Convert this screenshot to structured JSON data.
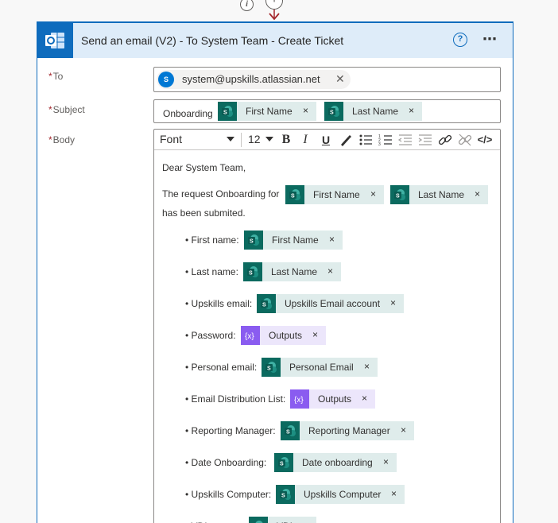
{
  "card": {
    "title": "Send an email (V2) - To System Team - Create Ticket",
    "help_symbol": "?",
    "more_symbol": "⋯"
  },
  "fields": {
    "to_label": "To",
    "subject_label": "Subject",
    "body_label": "Body",
    "required_mark": "*"
  },
  "to": {
    "avatar_initial": "S",
    "email": "system@upskills.atlassian.net"
  },
  "subject": {
    "prefix": "Onboarding",
    "tokens": [
      "First Name",
      "Last Name"
    ]
  },
  "toolbar": {
    "font": "Font",
    "size": "12"
  },
  "body": {
    "greeting": "Dear System Team,",
    "line1_text": "The request Onboarding for",
    "line1_tokens": [
      "First Name",
      "Last Name"
    ],
    "line2_text": "has been submited.",
    "items": [
      {
        "label": "• First name:",
        "token": "First Name",
        "kind": "sharepoint"
      },
      {
        "label": "• Last name:",
        "token": "Last Name",
        "kind": "sharepoint"
      },
      {
        "label": "• Upskills email:",
        "token": "Upskills Email account",
        "kind": "sharepoint"
      },
      {
        "label": "• Password:",
        "token": "Outputs",
        "kind": "variable"
      },
      {
        "label": "• Personal email:",
        "token": "Personal Email",
        "kind": "sharepoint"
      },
      {
        "label": "• Email Distribution List:",
        "token": "Outputs",
        "kind": "variable"
      },
      {
        "label": "• Reporting Manager:",
        "token": "Reporting Manager",
        "kind": "sharepoint"
      },
      {
        "label": "•  Date Onboarding:",
        "token": "Date onboarding",
        "kind": "sharepoint"
      },
      {
        "label": "• Upskills Computer:",
        "token": "Upskills Computer",
        "kind": "sharepoint"
      },
      {
        "label": "• VDI request:",
        "token": "VDI",
        "kind": "sharepoint"
      }
    ]
  },
  "colors": {
    "accent": "#0f6cbd",
    "header_bg": "#deecf9",
    "sharepoint_icon": "#0b6a5f",
    "sharepoint_token_bg": "#dfeceb",
    "variable_icon": "#8a5cf0",
    "variable_token_bg": "#ece6fb"
  },
  "icons": {
    "connector_info": "info-icon",
    "connector_add": "plus-icon",
    "app": "outlook-icon",
    "sharepoint_token": "sharepoint-icon",
    "variable_token": "variable-icon"
  }
}
